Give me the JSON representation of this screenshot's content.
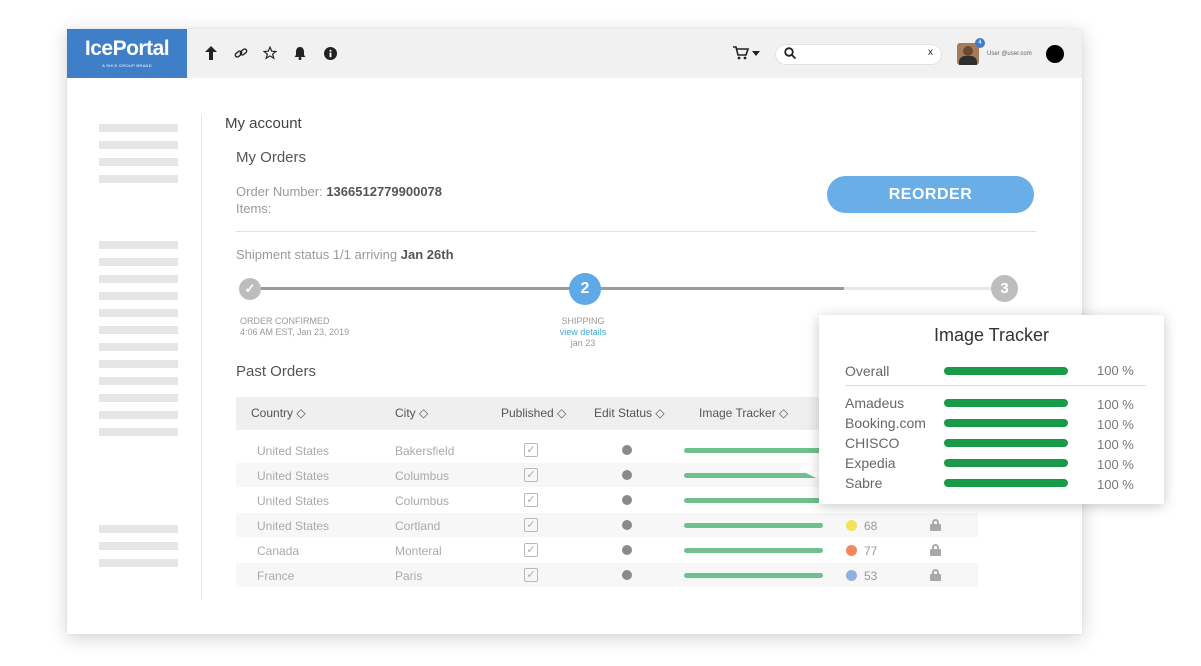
{
  "app": {
    "logo": "IcePortal",
    "logo_tagline": "A SHIJI GROUP BRAND",
    "toolbar_icons": [
      "upload-icon",
      "link-icon",
      "star-icon",
      "bell-icon",
      "info-icon"
    ],
    "search": {
      "placeholder": "",
      "value": "",
      "clear": "x"
    },
    "notification_count": "4",
    "user_email": "User @user.com"
  },
  "account": {
    "breadcrumb": "My account",
    "title": "My Orders",
    "order_number_label": "Order Number:",
    "order_number": "1366512779900078",
    "items_label": "Items:",
    "reorder_label": "REORDER",
    "shipment_status_text": "Shipment status 1/1 arriving",
    "shipment_date": "Jan 26th"
  },
  "progress": {
    "step1": {
      "symbol": "✓",
      "label": "ORDER CONFIRMED",
      "sub": "4:06 AM EST, Jan 23, 2019"
    },
    "step2": {
      "number": "2",
      "label": "SHIPPING",
      "link": "view details",
      "sub": "jan 23"
    },
    "step3": {
      "number": "3"
    }
  },
  "past_orders": {
    "title": "Past Orders",
    "headers": [
      "Country ◇",
      "City ◇",
      "Published ◇",
      "Edit Status ◇",
      "Image Tracker ◇"
    ],
    "rows": [
      {
        "country": "United States",
        "city": "Bakersfield",
        "published": "✓",
        "tracker": 1.0,
        "score": "",
        "score_color": ""
      },
      {
        "country": "United States",
        "city": "Columbus",
        "published": "✓",
        "tracker": 1.0,
        "score": "",
        "score_color": ""
      },
      {
        "country": "United States",
        "city": "Columbus",
        "published": "✓",
        "tracker": 1.0,
        "score": "",
        "score_color": ""
      },
      {
        "country": "United States",
        "city": "Cortland",
        "published": "✓",
        "tracker": 1.0,
        "score": "68",
        "score_color": "#f2e35a"
      },
      {
        "country": "Canada",
        "city": "Monteral",
        "published": "✓",
        "tracker": 1.0,
        "score": "77",
        "score_color": "#f08a5d"
      },
      {
        "country": "France",
        "city": "Paris",
        "published": "✓",
        "tracker": 1.0,
        "score": "53",
        "score_color": "#8fb0e0"
      }
    ]
  },
  "image_tracker": {
    "title": "Image Tracker",
    "overall": {
      "label": "Overall",
      "value": 1.0,
      "pct": "100 %"
    },
    "channels": [
      {
        "label": "Amadeus",
        "value": 1.0,
        "pct": "100 %"
      },
      {
        "label": "Booking.com",
        "value": 1.0,
        "pct": "100 %"
      },
      {
        "label": "CHISCO",
        "value": 1.0,
        "pct": "100 %"
      },
      {
        "label": "Expedia",
        "value": 1.0,
        "pct": "100 %"
      },
      {
        "label": "Sabre",
        "value": 1.0,
        "pct": "100 %"
      }
    ]
  },
  "colors": {
    "brand": "#3f7fc8",
    "button": "#6aaee7",
    "tracker_bar": "#6fc08e",
    "popup_bar": "#1a9a48",
    "step_active": "#5fa9e6",
    "step_inactive": "#bdbdbd"
  }
}
